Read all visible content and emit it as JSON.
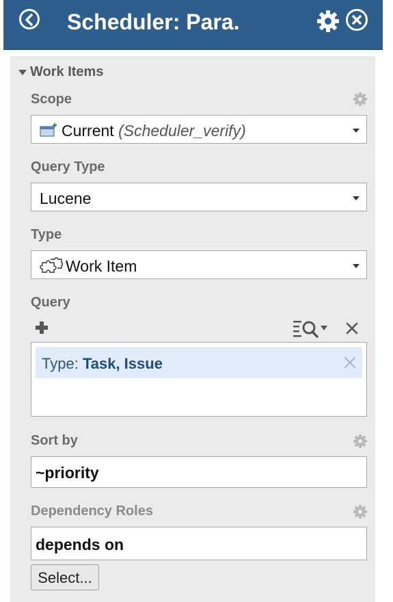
{
  "header": {
    "title": "Scheduler: Para."
  },
  "section": {
    "title": "Work Items"
  },
  "scope": {
    "label": "Scope",
    "value": "Current",
    "context": "(Scheduler_verify)"
  },
  "query_type": {
    "label": "Query Type",
    "value": "Lucene"
  },
  "type": {
    "label": "Type",
    "value": "Work Item"
  },
  "query": {
    "label": "Query",
    "chip_key": "Type:",
    "chip_value": "Task, Issue"
  },
  "sort_by": {
    "label": "Sort by",
    "value": "~priority"
  },
  "dependency_roles": {
    "label": "Dependency Roles",
    "value": "depends on",
    "select_label": "Select..."
  },
  "colors": {
    "header_bg": "#2e5f8c",
    "panel_bg": "#ebebeb",
    "chip_bg": "#e0ecf9",
    "chip_text": "#2a5680"
  }
}
